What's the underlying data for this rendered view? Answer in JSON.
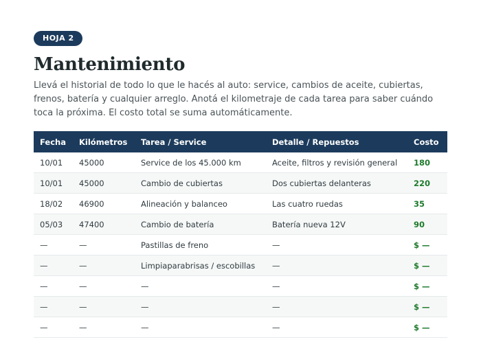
{
  "sheet": {
    "badge": "HOJA 2",
    "title": "Mantenimiento",
    "description": "Llevá el historial de todo lo que le hacés al auto: service, cambios de aceite, cubiertas, frenos, batería y cualquier arreglo. Anotá el kilometraje de cada tarea para saber cuándo toca la próxima. El costo total se suma automáticamente."
  },
  "table": {
    "headers": [
      "Fecha",
      "Kilómetros",
      "Tarea / Service",
      "Detalle / Repuestos",
      "Costo"
    ],
    "rows": [
      [
        "10/01",
        "45000",
        "Service de los 45.000 km",
        "Aceite, filtros y revisión general",
        "180"
      ],
      [
        "10/01",
        "45000",
        "Cambio de cubiertas",
        "Dos cubiertas delanteras",
        "220"
      ],
      [
        "18/02",
        "46900",
        "Alineación y balanceo",
        "Las cuatro ruedas",
        "35"
      ],
      [
        "05/03",
        "47400",
        "Cambio de batería",
        "Batería nueva 12V",
        "90"
      ],
      [
        "—",
        "—",
        "Pastillas de freno",
        "—",
        "$ —"
      ],
      [
        "—",
        "—",
        "Limpiaparabrisas / escobillas",
        "—",
        "$ —"
      ],
      [
        "—",
        "—",
        "—",
        "—",
        "$ —"
      ],
      [
        "—",
        "—",
        "—",
        "—",
        "$ —"
      ],
      [
        "—",
        "—",
        "—",
        "—",
        "$ —"
      ]
    ]
  },
  "colors": {
    "header_bg": "#1c3b5c",
    "cost_text": "#1e7a2c",
    "row_alt_bg": "#f6f8f7"
  }
}
